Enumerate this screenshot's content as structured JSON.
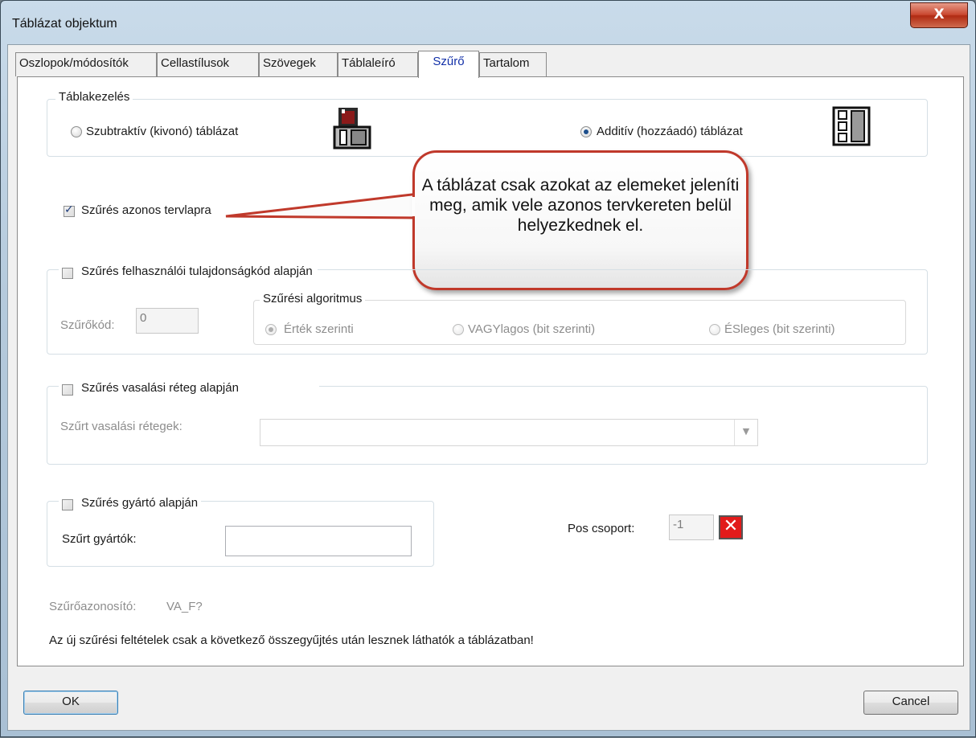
{
  "window": {
    "title": "Táblázat objektum",
    "close_label": "X"
  },
  "tabs": [
    {
      "label": "Oszlopok/módosítók",
      "active": false
    },
    {
      "label": "Cellastílusok",
      "active": false
    },
    {
      "label": "Szövegek",
      "active": false
    },
    {
      "label": "Táblaleíró",
      "active": false
    },
    {
      "label": "Szűrő",
      "active": true
    },
    {
      "label": "Tartalom",
      "active": false
    }
  ],
  "table_handling": {
    "group_label": "Táblakezelés",
    "subtractive_label": "Szubtraktív (kivonó) táblázat",
    "additive_label": "Additív (hozzáadó) táblázat",
    "selected": "additive"
  },
  "filter_same_sheet": {
    "label": "Szűrés azonos tervlapra",
    "checked": true
  },
  "callout": {
    "text": "A táblázat csak azokat az elemeket jeleníti meg, amik vele azonos tervkereten belül helyezkednek el."
  },
  "filter_user_property": {
    "label": "Szűrés felhasználói tulajdonságkód alapján",
    "checked": false,
    "code_label": "Szűrőkód:",
    "code_value": "0",
    "algorithm": {
      "group_label": "Szűrési algoritmus",
      "options": [
        "Érték szerinti",
        "VAGYlagos (bit szerinti)",
        "ÉSleges (bit szerinti)"
      ],
      "selected": "Érték szerinti"
    }
  },
  "filter_rebar_layer": {
    "label": "Szűrés vasalási réteg alapján",
    "checked": false,
    "layers_label": "Szűrt vasalási rétegek:",
    "layers_value": ""
  },
  "filter_manufacturer": {
    "label": "Szűrés gyártó alapján",
    "checked": false,
    "manufacturers_label": "Szűrt gyártók:",
    "manufacturers_value": ""
  },
  "pos_group": {
    "label": "Pos csoport:",
    "value": "-1",
    "clear_icon": "red-x-icon"
  },
  "filter_id": {
    "label": "Szűrőazonosító:",
    "value": "VA_F?"
  },
  "note": "Az új szűrési feltételek csak a következő összegyűjtés után lesznek láthatók a táblázatban!",
  "buttons": {
    "ok": "OK",
    "cancel": "Cancel"
  },
  "colors": {
    "callout_border": "#c0392b",
    "active_tab_text": "#1230a8",
    "clear_button": "#e21b1b"
  }
}
